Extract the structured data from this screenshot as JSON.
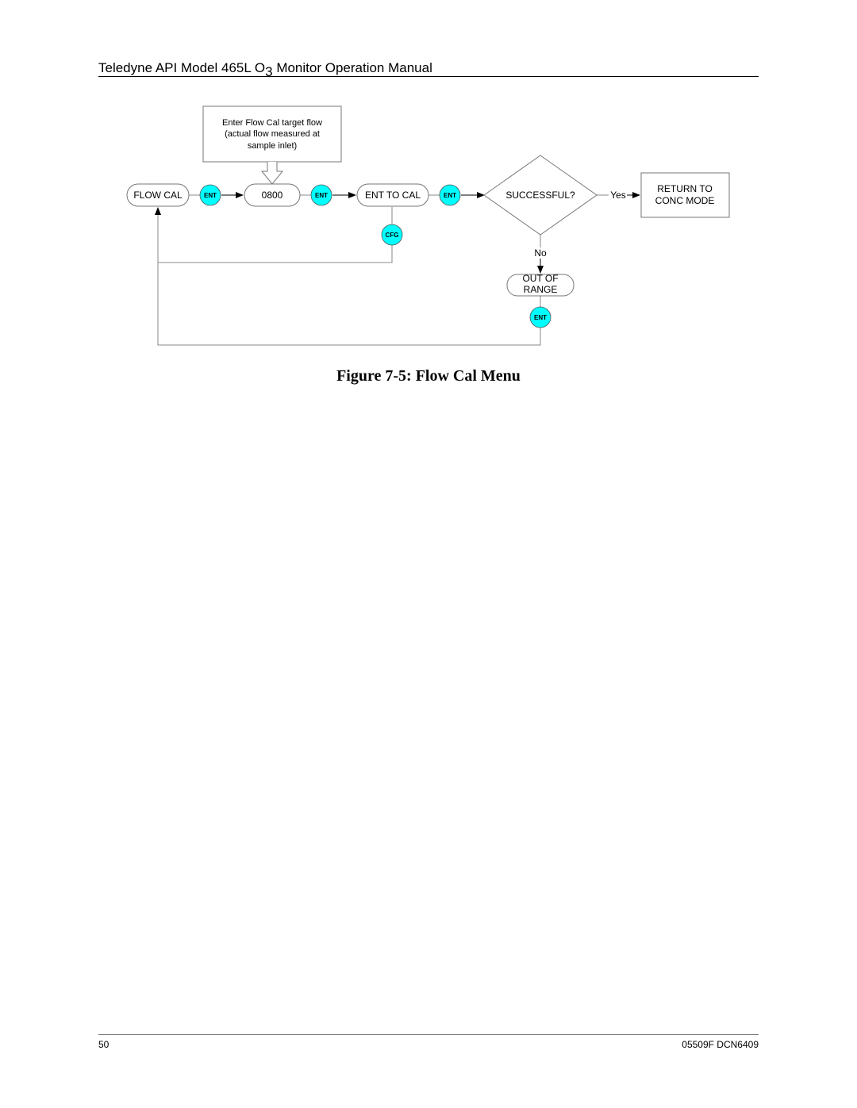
{
  "header": {
    "title_prefix": "Teledyne API Model 465L O",
    "title_subscript": "3",
    "title_suffix": " Monitor Operation Manual"
  },
  "diagram": {
    "note_lines": [
      "Enter Flow Cal target flow",
      "(actual flow measured at",
      "sample inlet)"
    ],
    "nodes": {
      "flow_cal": "FLOW CAL",
      "value": "0800",
      "ent_to_cal": "ENT TO CAL",
      "decision": "SUCCESSFUL?",
      "return_lines": [
        "RETURN TO",
        "CONC MODE"
      ],
      "out_of_range_lines": [
        "OUT OF",
        "RANGE"
      ]
    },
    "buttons": {
      "ent_1": "ENT",
      "ent_2": "ENT",
      "ent_3": "ENT",
      "cfg": "CFG",
      "ent_4": "ENT"
    },
    "edge_labels": {
      "yes": "Yes",
      "no": "No"
    },
    "colors": {
      "button_fill": "#00ffff",
      "line": "#888888"
    }
  },
  "caption": "Figure 7-5:  Flow Cal Menu",
  "footer": {
    "page_number": "50",
    "doc_id": "05509F DCN6409"
  }
}
